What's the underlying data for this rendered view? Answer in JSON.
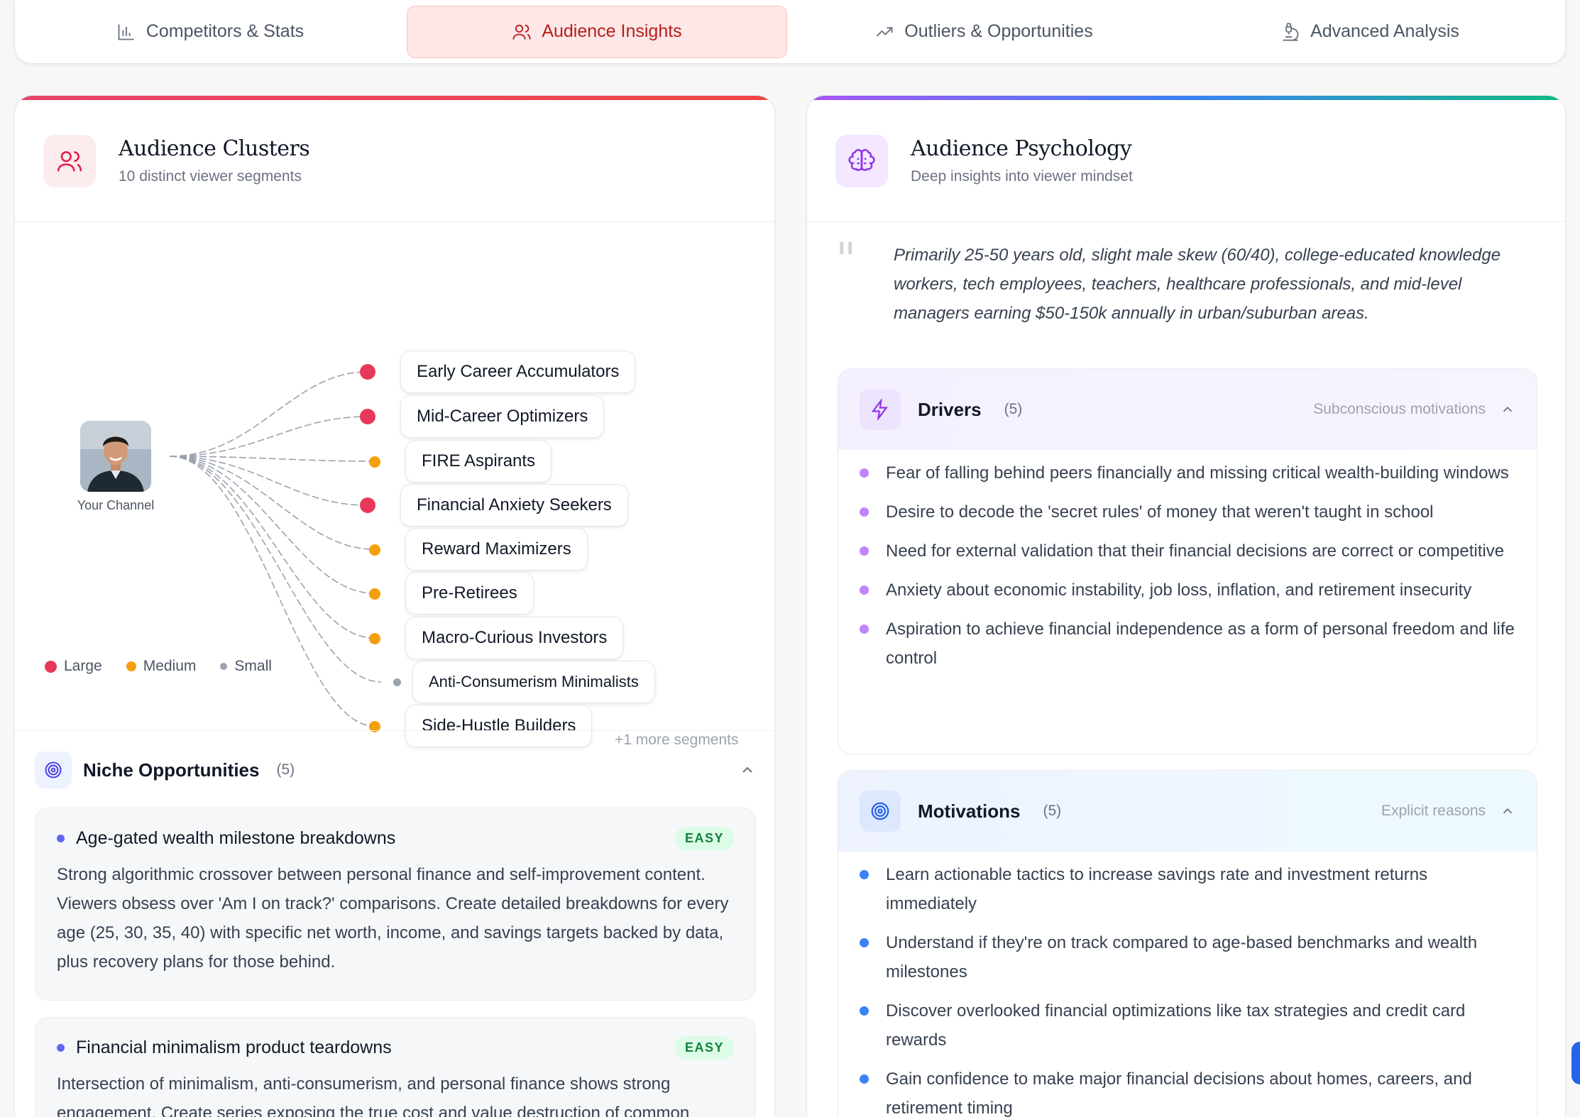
{
  "tabs": [
    {
      "label": "Competitors & Stats",
      "icon": "bar-chart-icon"
    },
    {
      "label": "Audience Insights",
      "icon": "users-icon"
    },
    {
      "label": "Outliers & Opportunities",
      "icon": "trending-up-icon"
    },
    {
      "label": "Advanced Analysis",
      "icon": "microscope-icon"
    }
  ],
  "clusters": {
    "title": "Audience Clusters",
    "subtitle": "10 distinct viewer segments",
    "center_label": "Your Channel",
    "segments": [
      {
        "label": "Early Career Accumulators",
        "size": "large"
      },
      {
        "label": "Mid-Career Optimizers",
        "size": "large"
      },
      {
        "label": "FIRE Aspirants",
        "size": "medium"
      },
      {
        "label": "Financial Anxiety Seekers",
        "size": "large"
      },
      {
        "label": "Reward Maximizers",
        "size": "medium"
      },
      {
        "label": "Pre-Retirees",
        "size": "medium"
      },
      {
        "label": "Macro-Curious Investors",
        "size": "medium"
      },
      {
        "label": "Anti-Consumerism Minimalists",
        "size": "small"
      },
      {
        "label": "Side-Hustle Builders",
        "size": "medium"
      }
    ],
    "more": "+1 more segments",
    "legend": {
      "large": "Large",
      "medium": "Medium",
      "small": "Small"
    },
    "colors": {
      "large": "#e8385a",
      "medium": "#f59e0b",
      "small": "#9ca3af"
    }
  },
  "niche": {
    "title": "Niche Opportunities",
    "count": "(5)",
    "items": [
      {
        "title": "Age-gated wealth milestone breakdowns",
        "badge": "EASY",
        "body": "Strong algorithmic crossover between personal finance and self-improvement content. Viewers obsess over 'Am I on track?' comparisons. Create detailed breakdowns for every age (25, 30, 35, 40) with specific net worth, income, and savings targets backed by data, plus recovery plans for those behind."
      },
      {
        "title": "Financial minimalism product teardowns",
        "badge": "EASY",
        "body": "Intersection of minimalism, anti-consumerism, and personal finance shows strong engagement. Create series exposing the true cost and value destruction of common"
      }
    ]
  },
  "psychology": {
    "title": "Audience Psychology",
    "subtitle": "Deep insights into viewer mindset",
    "quote": "Primarily 25-50 years old, slight male skew (60/40), college-educated knowledge workers, tech employees, teachers, healthcare professionals, and mid-level managers earning $50-150k annually in urban/suburban areas.",
    "drivers": {
      "title": "Drivers",
      "count": "(5)",
      "hint": "Subconscious motivations",
      "items": [
        "Fear of falling behind peers financially and missing critical wealth-building windows",
        "Desire to decode the 'secret rules' of money that weren't taught in school",
        "Need for external validation that their financial decisions are correct or competitive",
        "Anxiety about economic instability, job loss, inflation, and retirement insecurity",
        "Aspiration to achieve financial independence as a form of personal freedom and life control"
      ]
    },
    "motivations": {
      "title": "Motivations",
      "count": "(5)",
      "hint": "Explicit reasons",
      "items": [
        "Learn actionable tactics to increase savings rate and investment returns immediately",
        "Understand if they're on track compared to age-based benchmarks and wealth milestones",
        "Discover overlooked financial optimizations like tax strategies and credit card rewards",
        "Gain confidence to make major financial decisions about homes, careers, and retirement timing"
      ]
    }
  }
}
